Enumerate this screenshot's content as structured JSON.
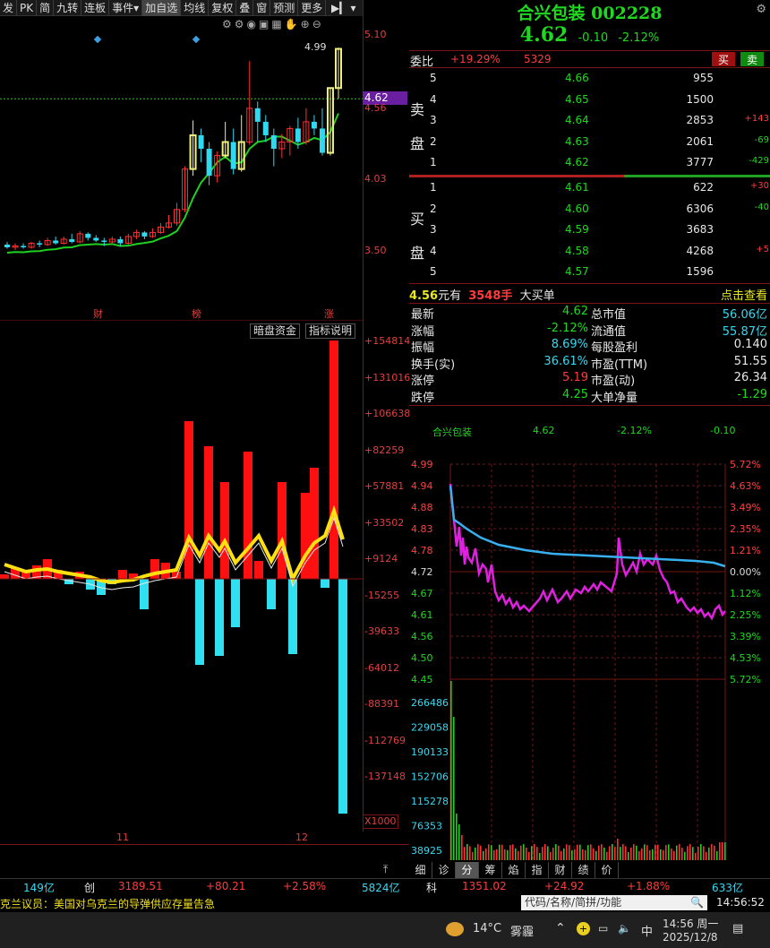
{
  "toolbar": {
    "items": [
      "发",
      "PK",
      "简",
      "九转",
      "连板",
      "事件▾",
      "加自选",
      "均线",
      "复权",
      "叠",
      "窗",
      "预测",
      "更多"
    ]
  },
  "kline": {
    "price_labels": [
      "5.10",
      "4.56",
      "4.03",
      "3.50"
    ],
    "current_price": "4.62",
    "high_label": "4.99",
    "event_labels": [
      "财",
      "榜",
      "涨"
    ],
    "candles": [
      [
        3.54,
        3.52,
        3.56,
        3.51,
        1
      ],
      [
        3.52,
        3.53,
        3.55,
        3.5,
        1
      ],
      [
        3.53,
        3.52,
        3.55,
        3.51,
        0
      ],
      [
        3.52,
        3.55,
        3.56,
        3.51,
        1
      ],
      [
        3.55,
        3.54,
        3.57,
        3.52,
        0
      ],
      [
        3.54,
        3.57,
        3.59,
        3.53,
        1
      ],
      [
        3.57,
        3.55,
        3.6,
        3.54,
        0
      ],
      [
        3.55,
        3.58,
        3.6,
        3.54,
        1
      ],
      [
        3.58,
        3.56,
        3.62,
        3.55,
        0
      ],
      [
        3.56,
        3.62,
        3.64,
        3.55,
        1
      ],
      [
        3.62,
        3.59,
        3.63,
        3.57,
        0
      ],
      [
        3.59,
        3.57,
        3.61,
        3.56,
        0
      ],
      [
        3.57,
        3.56,
        3.59,
        3.53,
        0
      ],
      [
        3.56,
        3.58,
        3.6,
        3.54,
        1
      ],
      [
        3.58,
        3.55,
        3.6,
        3.53,
        0
      ],
      [
        3.55,
        3.6,
        3.62,
        3.54,
        1
      ],
      [
        3.6,
        3.63,
        3.65,
        3.58,
        1
      ],
      [
        3.63,
        3.6,
        3.64,
        3.58,
        0
      ],
      [
        3.6,
        3.63,
        3.66,
        3.59,
        1
      ],
      [
        3.63,
        3.67,
        3.7,
        3.62,
        1
      ],
      [
        3.67,
        3.7,
        3.76,
        3.66,
        1
      ],
      [
        3.7,
        3.8,
        3.85,
        3.68,
        1
      ],
      [
        3.8,
        4.1,
        4.12,
        3.78,
        1
      ],
      [
        4.1,
        4.35,
        4.46,
        4.05,
        0
      ],
      [
        4.35,
        4.25,
        4.4,
        4.15,
        1
      ],
      [
        4.25,
        4.05,
        4.3,
        3.98,
        1
      ],
      [
        4.05,
        4.2,
        4.23,
        4.0,
        1
      ],
      [
        4.2,
        4.3,
        4.45,
        4.18,
        0
      ],
      [
        4.3,
        4.1,
        4.4,
        4.06,
        0
      ],
      [
        4.1,
        4.3,
        4.5,
        4.08,
        0
      ],
      [
        4.3,
        4.55,
        4.9,
        4.28,
        1
      ],
      [
        4.55,
        4.45,
        4.6,
        4.3,
        1
      ],
      [
        4.45,
        4.35,
        4.5,
        4.3,
        0
      ],
      [
        4.35,
        4.25,
        4.4,
        4.12,
        1
      ],
      [
        4.25,
        4.3,
        4.36,
        4.18,
        1
      ],
      [
        4.3,
        4.4,
        4.42,
        4.2,
        1
      ],
      [
        4.4,
        4.3,
        4.48,
        4.25,
        0
      ],
      [
        4.3,
        4.45,
        4.55,
        4.28,
        1
      ],
      [
        4.45,
        4.4,
        4.5,
        4.35,
        1
      ],
      [
        4.4,
        4.22,
        4.55,
        4.2,
        0
      ],
      [
        4.22,
        4.7,
        4.7,
        4.2,
        0
      ],
      [
        4.7,
        4.99,
        5.0,
        4.62,
        0
      ]
    ]
  },
  "lower": {
    "buttons": [
      "暗盘资金",
      "指标说明"
    ],
    "axis_labels": [
      "+154814",
      "+131016",
      "+106638",
      "+82259",
      "+57881",
      "+33502",
      "+9124",
      "-15255",
      "-39633",
      "-64012",
      "-88391",
      "-112769",
      "-137148"
    ],
    "unit": "X1000",
    "x_labels": [
      "11",
      "12"
    ]
  },
  "stock": {
    "name": "合兴包装",
    "code": "002228",
    "price": "4.62",
    "change": "-0.10",
    "pct": "-2.12%"
  },
  "weibi": {
    "label": "委比",
    "value": "+19.29%",
    "diff": "5329",
    "buy_btn": "买",
    "sell_btn": "卖"
  },
  "sell": [
    {
      "lvl": "5",
      "price": "4.66",
      "vol": "955",
      "chg": ""
    },
    {
      "lvl": "4",
      "price": "4.65",
      "vol": "1500",
      "chg": ""
    },
    {
      "lvl": "3",
      "price": "4.64",
      "vol": "2853",
      "chg": "+143"
    },
    {
      "lvl": "2",
      "price": "4.63",
      "vol": "2061",
      "chg": "-69"
    },
    {
      "lvl": "1",
      "price": "4.62",
      "vol": "3777",
      "chg": "-429"
    }
  ],
  "buy": [
    {
      "lvl": "1",
      "price": "4.61",
      "vol": "622",
      "chg": "+30"
    },
    {
      "lvl": "2",
      "price": "4.60",
      "vol": "6306",
      "chg": "-40"
    },
    {
      "lvl": "3",
      "price": "4.59",
      "vol": "3683",
      "chg": ""
    },
    {
      "lvl": "4",
      "price": "4.58",
      "vol": "4268",
      "chg": "+5"
    },
    {
      "lvl": "5",
      "price": "4.57",
      "vol": "1596",
      "chg": ""
    }
  ],
  "sell_side": "卖盘",
  "buy_side": "买盘",
  "bigorder": {
    "price": "4.56",
    "text1": "元有",
    "vol": "3548手",
    "text2": "大买单",
    "link": "点击查看"
  },
  "stats": [
    {
      "l1": "最新",
      "v1": "4.62",
      "c1": "grn",
      "l2": "总市值",
      "v2": "56.06亿",
      "c2": "cyan"
    },
    {
      "l1": "涨幅",
      "v1": "-2.12%",
      "c1": "grn",
      "l2": "流通值",
      "v2": "55.87亿",
      "c2": "cyan"
    },
    {
      "l1": "振幅",
      "v1": "8.69%",
      "c1": "cyan",
      "l2": "每股盈利",
      "v2": "0.140",
      "c2": "wht"
    },
    {
      "l1": "换手(实)",
      "v1": "36.61%",
      "c1": "cyan",
      "l2": "市盈(TTM)",
      "v2": "51.55",
      "c2": "wht"
    },
    {
      "l1": "涨停",
      "v1": "5.19",
      "c1": "red",
      "l2": "市盈(动)",
      "v2": "26.34",
      "c2": "wht"
    },
    {
      "l1": "跌停",
      "v1": "4.25",
      "c1": "grn",
      "l2": "大单净量",
      "v2": "-1.29",
      "c2": "grn"
    }
  ],
  "intraday": {
    "header": {
      "name": "合兴包装",
      "price": "4.62",
      "pct": "-2.12%",
      "chg": "-0.10"
    },
    "left_labels": [
      "4.99",
      "4.94",
      "4.88",
      "4.83",
      "4.78",
      "4.72",
      "4.67",
      "4.61",
      "4.56",
      "4.50",
      "4.45"
    ],
    "right_labels": [
      "5.72%",
      "4.63%",
      "3.49%",
      "2.35%",
      "1.21%",
      "0.00%",
      "1.12%",
      "2.25%",
      "3.39%",
      "4.53%",
      "5.72%"
    ],
    "vol_labels": [
      "266486",
      "229058",
      "190133",
      "152706",
      "115278",
      "76353",
      "38925"
    ]
  },
  "tabs": [
    "细",
    "诊",
    "分",
    "筹",
    "焰",
    "指",
    "财",
    "绩",
    "价"
  ],
  "bottom": {
    "a": "149亿",
    "b": "创",
    "c": "3189.51",
    "d": "+80.21",
    "e": "+2.58%",
    "f": "5824亿",
    "g": "科",
    "h": "1351.02",
    "i": "+24.92",
    "j": "+1.88%",
    "k": "633亿"
  },
  "ticker": {
    "news": "克兰议员：美国对乌克兰的导弹供应存量告急",
    "search": "代码/名称/简拼/功能",
    "time": "14:56:52"
  },
  "taskbar": {
    "temp": "14°C",
    "weather": "雾霾",
    "ime": "中",
    "time": "14:56 周一",
    "date": "2025/12/8"
  }
}
